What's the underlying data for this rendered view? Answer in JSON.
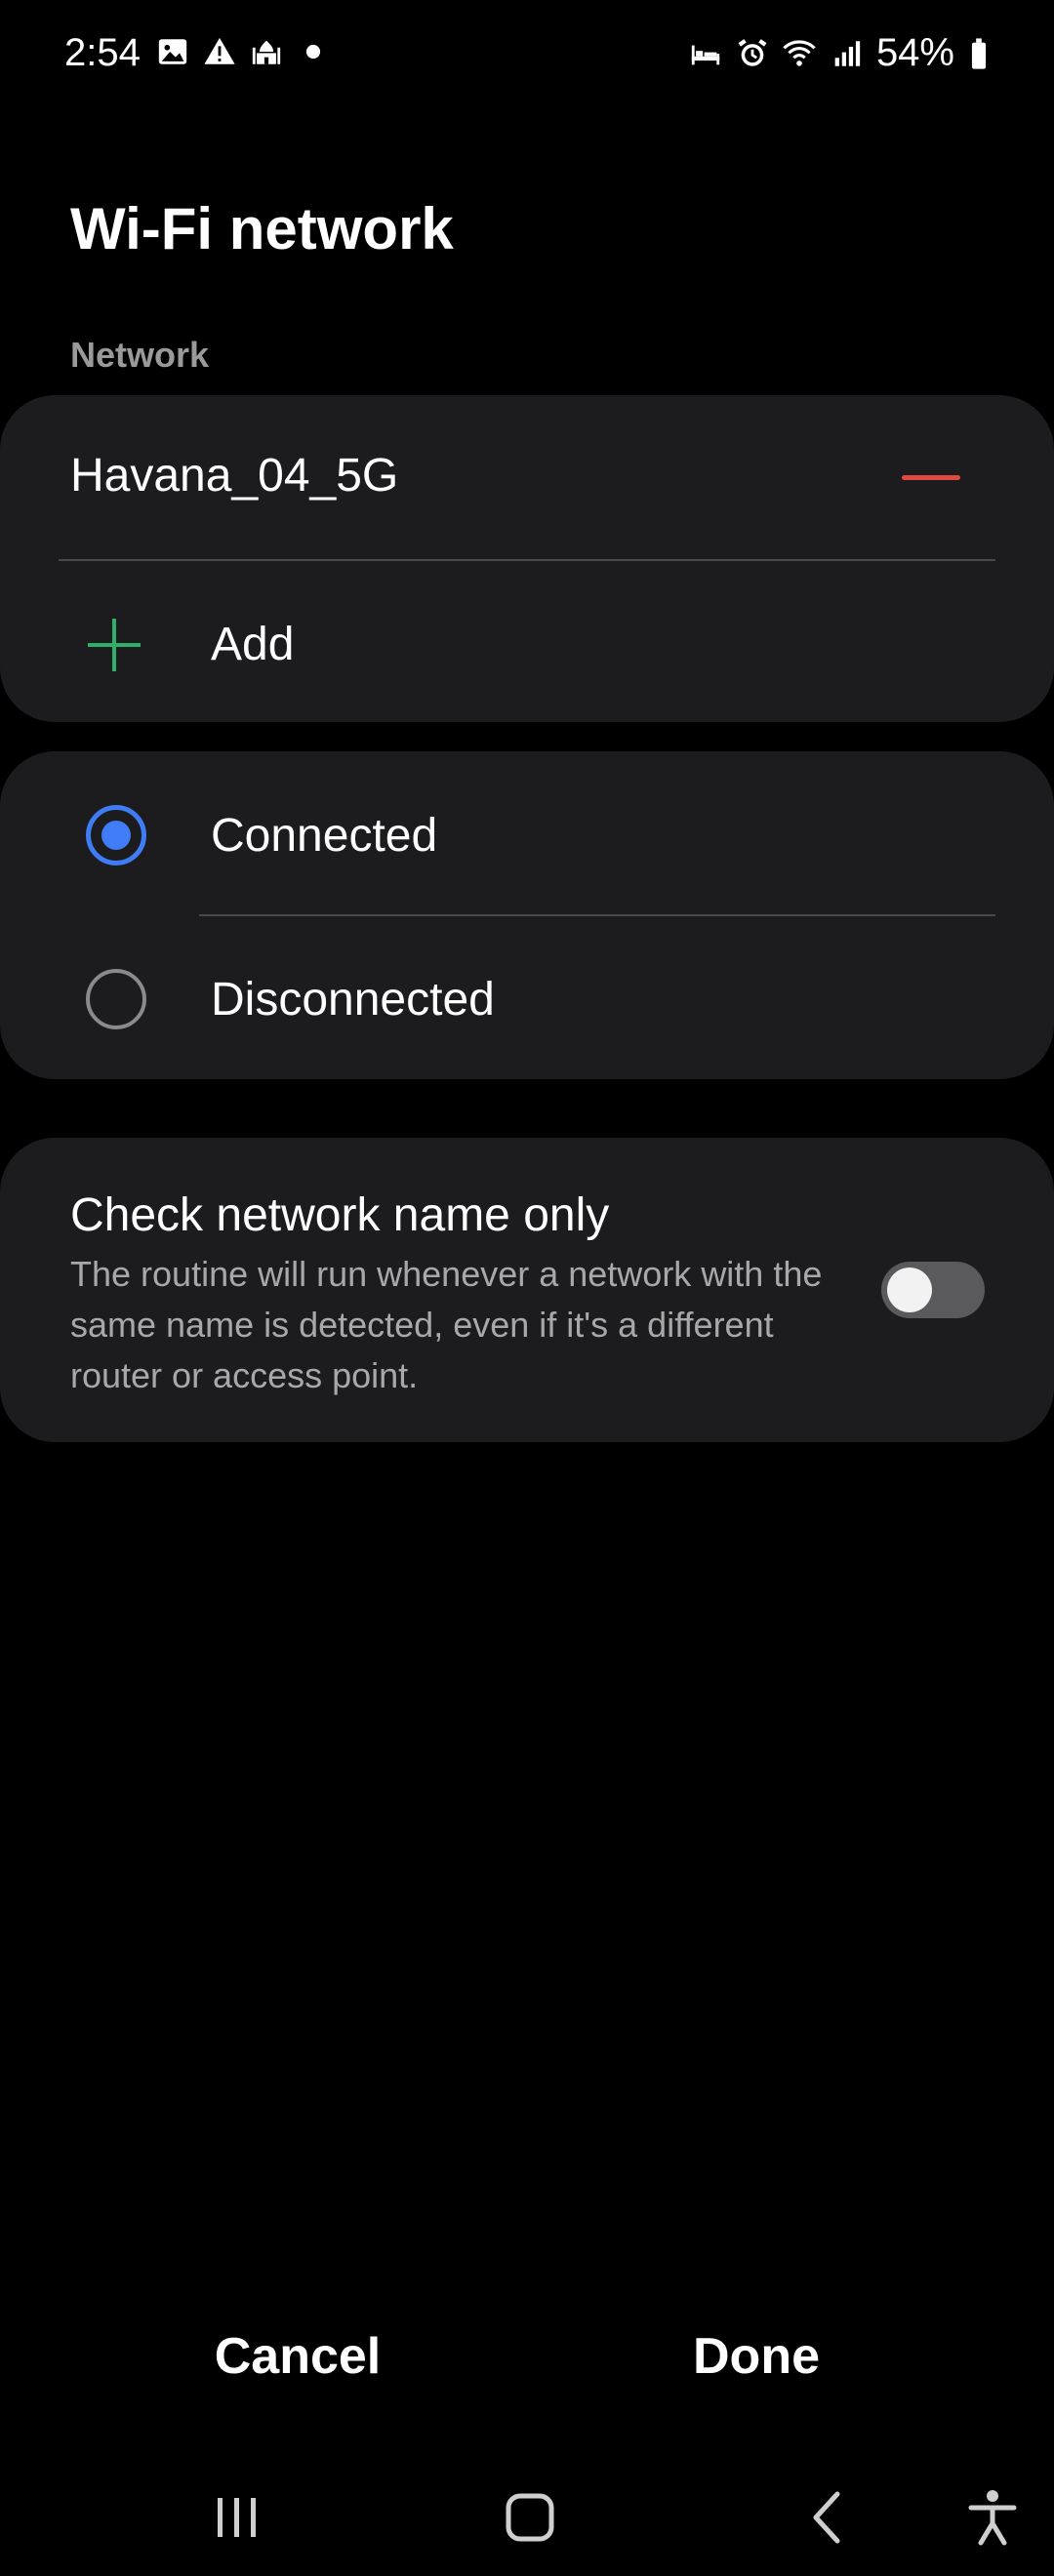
{
  "status_bar": {
    "time": "2:54",
    "left_icons": [
      "gallery-icon",
      "alert-icon",
      "mosque-icon",
      "dot-icon"
    ],
    "right_icons": [
      "bed-icon",
      "alarm-icon",
      "wifi-icon",
      "signal-icon",
      "battery-icon"
    ],
    "battery_percent": "54%"
  },
  "page": {
    "title": "Wi-Fi network",
    "section_label": "Network"
  },
  "network_card": {
    "network_name": "Havana_04_5G",
    "add_label": "Add"
  },
  "state_card": {
    "options": [
      {
        "label": "Connected",
        "selected": true
      },
      {
        "label": "Disconnected",
        "selected": false
      }
    ]
  },
  "check_card": {
    "title": "Check network name only",
    "description": "The routine will run whenever a network with the same name is detected, even if it's a different router or access point.",
    "toggle_on": false
  },
  "actions": {
    "cancel_label": "Cancel",
    "done_label": "Done"
  },
  "colors": {
    "accent": "#3f7cf5",
    "remove": "#e04a3f",
    "add": "#2fb06a",
    "card": "#1c1c1e",
    "background": "#000000"
  }
}
